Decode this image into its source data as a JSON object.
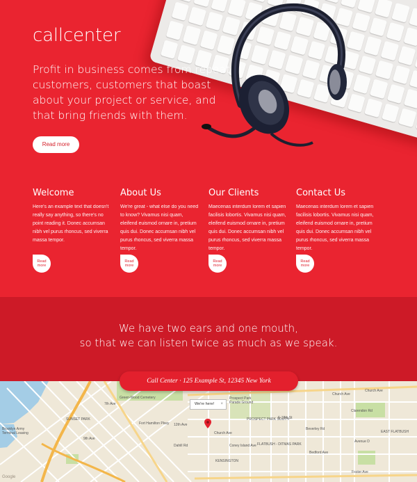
{
  "hero": {
    "logo": "callcenter",
    "tagline": "Profit in business comes from repeat customers, customers that boast about your project or service, and that bring friends with them.",
    "button": "Read more"
  },
  "features": [
    {
      "title": "Welcome",
      "text": "Here's an example text that doesn't really say anything, so there's no point reading it. Donec accumsan nibh vel purus rhoncus, sed viverra massa tempor.",
      "button": "Read more"
    },
    {
      "title": "About Us",
      "text": "We're great - what else do you need to know? Vivamus nisi quam, eleifend euismod ornare in, pretium quis dui. Donec accumsan nibh vel purus rhoncus, sed viverra massa tempor.",
      "button": "Read more"
    },
    {
      "title": "Our Clients",
      "text": "Maecenas interdum lorem et sapien facilisis lobortis. Vivamus nisi quam, eleifend euismod ornare in, pretium quis dui. Donec accumsan nibh vel purus rhoncus, sed viverra massa tempor.",
      "button": "Read more"
    },
    {
      "title": "Contact Us",
      "text": "Maecenas interdum lorem et sapien facilisis lobortis. Vivamus nisi quam, eleifend euismod ornare in, pretium quis dui. Donec accumsan nibh vel purus rhoncus, sed viverra massa tempor.",
      "button": "Read more"
    }
  ],
  "quote": {
    "line1": "We have two ears and one mouth,",
    "line2": "so that we can listen twice as much as we speak."
  },
  "map": {
    "address": "Call Center · 125 Example St, 12345 New York",
    "bubble": "We're here!",
    "bubble_close": "×",
    "attribution": "Google",
    "labels": {
      "brooklyn_army": "Brooklyn Army",
      "terminal": "Terminal Leasing",
      "sunset_park": "SUNSET PARK",
      "green_wood": "Green-Wood Cemetery",
      "prospect_park": "Prospect Park",
      "parade_ground": "Parade Ground",
      "prospect_south": "PROSPECT PARK SOUTH",
      "flatbush": "FLATBUSH - DITMAS PARK",
      "kensington": "KENSINGTON",
      "church_ave": "Church Ave",
      "clarendon": "Clarendon Rd",
      "beverley": "Beverley Rd",
      "avenue_d": "Avenue D",
      "east_flatbush": "EAST FLATBUSH",
      "foster": "Foster Ave",
      "coney": "Coney Island Ave",
      "fort_hamilton": "Fort Hamilton Pkwy",
      "ocean_pkwy": "Ocean Pkwy",
      "third_ave": "3rd Ave",
      "fourth_ave": "4th Ave",
      "fifth_ave": "5th Ave",
      "sixth_ave": "6th Ave",
      "seventh_ave": "7th Ave",
      "eighth_ave": "8th Ave",
      "ninth_ave": "9th Ave",
      "tenth_ave": "10th Ave",
      "twelfth_ave": "12th Ave",
      "thirteenth_ave": "13th Ave",
      "dahill": "Dahill Rd",
      "e_18": "E 18th St",
      "e_31": "E 31st St",
      "e_35": "E 35th St",
      "e_49": "E 49th St",
      "e_51": "E 51st St",
      "bedford": "Bedford Ave",
      "nostrand": "Nostrand Ave",
      "rogers": "Rogers Ave"
    }
  }
}
